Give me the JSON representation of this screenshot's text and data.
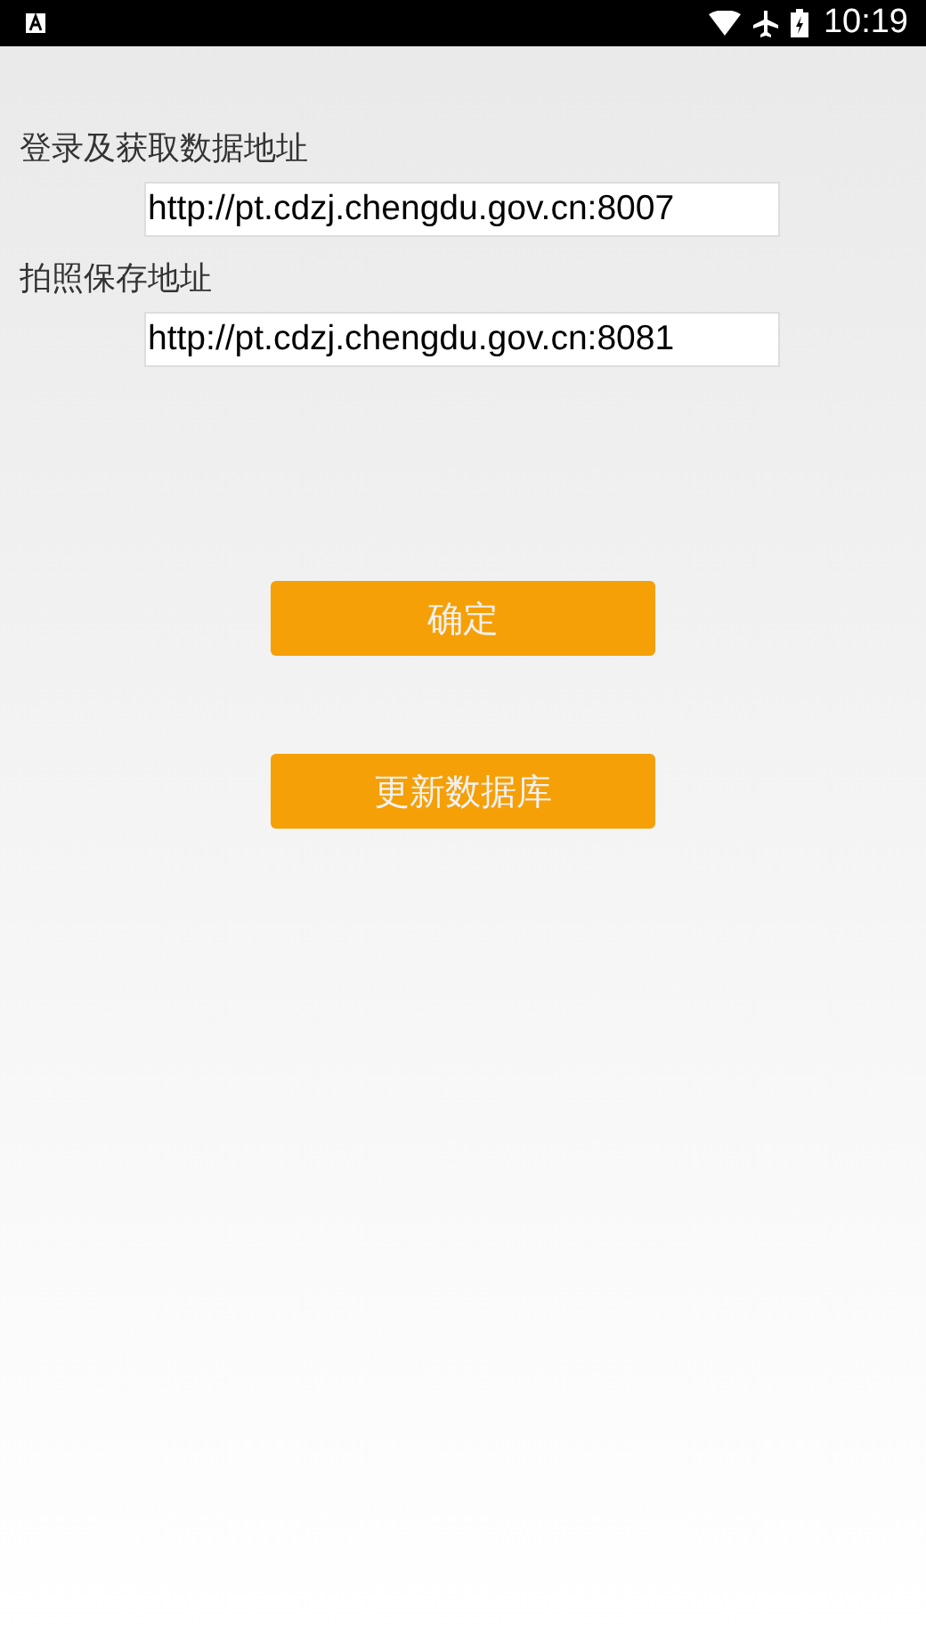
{
  "status_bar": {
    "time": "10:19"
  },
  "fields": [
    {
      "label": "登录及获取数据地址",
      "value": "http://pt.cdzj.chengdu.gov.cn:8007"
    },
    {
      "label": "拍照保存地址",
      "value": "http://pt.cdzj.chengdu.gov.cn:8081"
    }
  ],
  "buttons": [
    "确定",
    "更新数据库"
  ]
}
